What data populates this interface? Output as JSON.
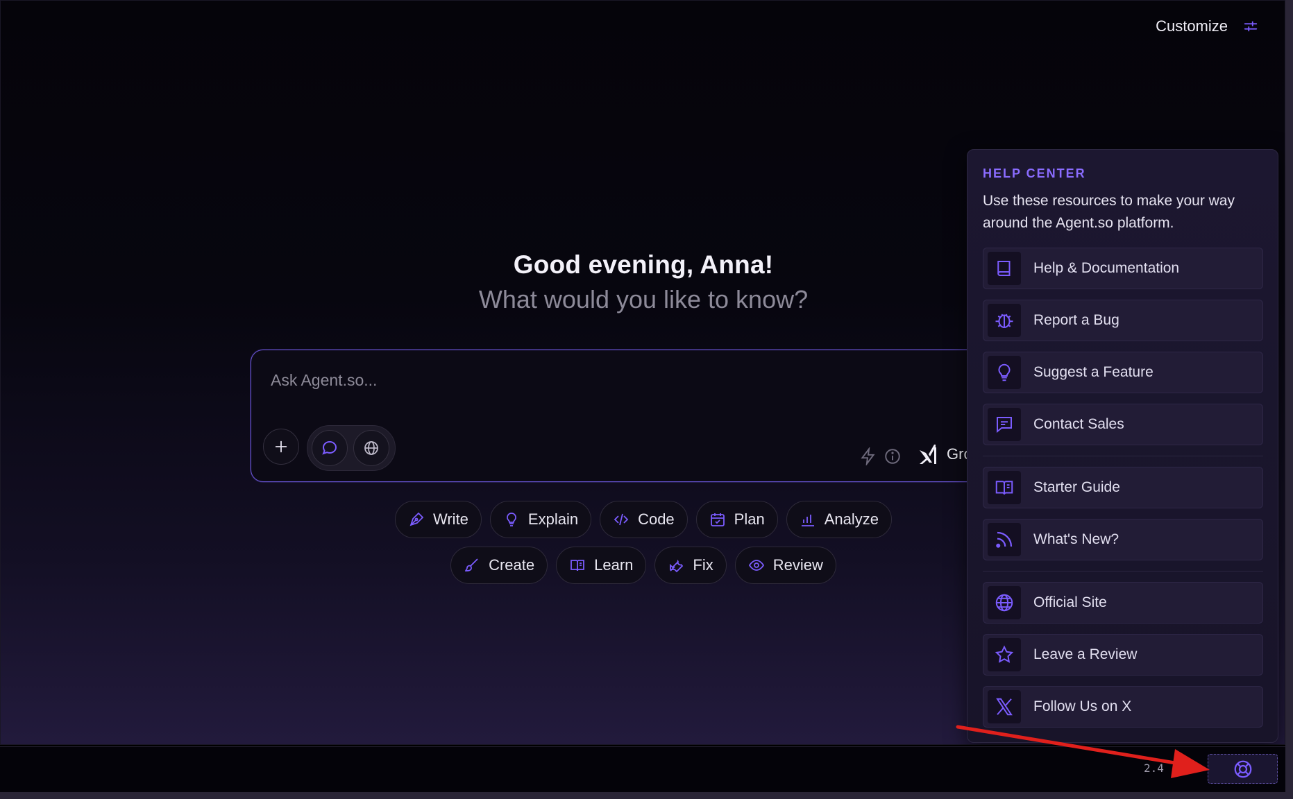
{
  "header": {
    "customize_label": "Customize"
  },
  "greeting": {
    "title": "Good evening, Anna!",
    "subtitle": "What would you like to know?"
  },
  "composer": {
    "placeholder": "Ask Agent.so...",
    "model_label": "Gro"
  },
  "actions_row1": [
    {
      "label": "Write",
      "icon": "pen-icon"
    },
    {
      "label": "Explain",
      "icon": "lightbulb-icon"
    },
    {
      "label": "Code",
      "icon": "code-icon"
    },
    {
      "label": "Plan",
      "icon": "calendar-icon"
    },
    {
      "label": "Analyze",
      "icon": "bar-chart-icon"
    }
  ],
  "actions_row2": [
    {
      "label": "Create",
      "icon": "brush-icon"
    },
    {
      "label": "Learn",
      "icon": "book-open-icon"
    },
    {
      "label": "Fix",
      "icon": "wrench-icon"
    },
    {
      "label": "Review",
      "icon": "eye-icon"
    }
  ],
  "help_center": {
    "title": "HELP CENTER",
    "description": "Use these resources to make your way around the Agent.so platform.",
    "items": [
      {
        "label": "Help & Documentation",
        "icon": "book-icon"
      },
      {
        "label": "Report a Bug",
        "icon": "bug-icon"
      },
      {
        "label": "Suggest a Feature",
        "icon": "lightbulb-icon"
      },
      {
        "label": "Contact Sales",
        "icon": "message-icon"
      },
      {
        "label": "Starter Guide",
        "icon": "book-open-icon"
      },
      {
        "label": "What's New?",
        "icon": "rss-icon"
      },
      {
        "label": "Official Site",
        "icon": "globe-icon"
      },
      {
        "label": "Leave a Review",
        "icon": "star-icon"
      },
      {
        "label": "Follow Us on X",
        "icon": "x-logo-icon"
      }
    ]
  },
  "footer": {
    "version": "2.4"
  },
  "colors": {
    "accent": "#7b5cff",
    "panel": "#1c1730",
    "background": "#05040a",
    "annotation_arrow": "#e0201c"
  }
}
